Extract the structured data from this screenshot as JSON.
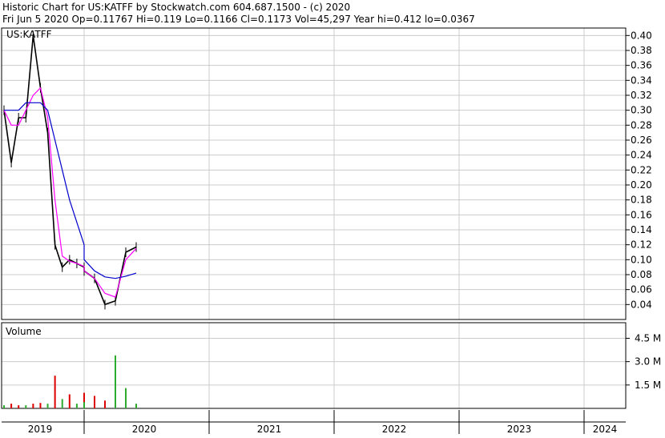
{
  "header": {
    "line1": "Historic Chart for US:KATFF by Stockwatch.com 604.687.1500 - (c) 2020",
    "line2": "Fri Jun  5 2020   Op=0.11767   Hi=0.119   Lo=0.1166   Cl=0.1173   Vol=45,297   Year hi=0.412   lo=0.0367"
  },
  "colors": {
    "price": "#000000",
    "ma_short": "#ff00ff",
    "ma_long": "#0000cc",
    "volume_up": "#2eaa2e",
    "volume_down": "#dd0000",
    "grid": "#cccccc"
  },
  "chart_data": [
    {
      "type": "line",
      "symbol_label": "US:KATFF",
      "ylim": [
        0.02,
        0.41
      ],
      "y_ticks": [
        "0.40",
        "0.38",
        "0.36",
        "0.34",
        "0.32",
        "0.30",
        "0.28",
        "0.26",
        "0.24",
        "0.22",
        "0.20",
        "0.18",
        "0.16",
        "0.14",
        "0.12",
        "0.10",
        "0.08",
        "0.06",
        "0.04"
      ],
      "x_ticks": [
        "2019",
        "2020",
        "2021",
        "2022",
        "2023",
        "2024"
      ],
      "grid": true,
      "series": [
        {
          "key": "price",
          "x": [
            "2019-01",
            "2019-02",
            "2019-03",
            "2019-04",
            "2019-05",
            "2019-06",
            "2019-07",
            "2019-08",
            "2019-09",
            "2019-10",
            "2019-11",
            "2019-12",
            "2020-01",
            "2020-02",
            "2020-03",
            "2020-04",
            "2020-05",
            "2020-06"
          ],
          "values": [
            0.3,
            0.23,
            0.29,
            0.29,
            0.4,
            0.33,
            0.27,
            0.12,
            0.09,
            0.1,
            0.095,
            0.09,
            0.085,
            0.075,
            0.04,
            0.045,
            0.11,
            0.117
          ]
        },
        {
          "key": "ma_short",
          "x": [
            "2019-01",
            "2019-02",
            "2019-03",
            "2019-04",
            "2019-05",
            "2019-06",
            "2019-07",
            "2019-08",
            "2019-09",
            "2019-10",
            "2019-11",
            "2019-12",
            "2020-01",
            "2020-02",
            "2020-03",
            "2020-04",
            "2020-05",
            "2020-06"
          ],
          "values": [
            0.3,
            0.28,
            0.28,
            0.3,
            0.32,
            0.33,
            0.29,
            0.18,
            0.105,
            0.098,
            0.095,
            0.091,
            0.085,
            0.075,
            0.055,
            0.05,
            0.1,
            0.115
          ]
        },
        {
          "key": "ma_long",
          "x": [
            "2019-01",
            "2019-02",
            "2019-03",
            "2019-04",
            "2019-05",
            "2019-06",
            "2019-07",
            "2019-08",
            "2019-09",
            "2019-10",
            "2019-11",
            "2019-12",
            "2020-01",
            "2020-02",
            "2020-03",
            "2020-04",
            "2020-05",
            "2020-06"
          ],
          "values": [
            0.3,
            0.3,
            0.3,
            0.31,
            0.31,
            0.31,
            0.3,
            0.26,
            0.22,
            0.18,
            0.15,
            0.12,
            0.1,
            0.085,
            0.077,
            0.075,
            0.078,
            0.082
          ]
        }
      ]
    },
    {
      "type": "bar",
      "title": "Volume",
      "ylim": [
        0,
        5.5
      ],
      "y_ticks": [
        "4.5 M",
        "3.0 M",
        "1.5 M"
      ],
      "y_tick_values": [
        4.5,
        3.0,
        1.5
      ],
      "x": [
        "2019-01",
        "2019-02",
        "2019-03",
        "2019-04",
        "2019-05",
        "2019-06",
        "2019-07",
        "2019-08",
        "2019-09",
        "2019-10",
        "2019-11",
        "2019-12",
        "2020-01",
        "2020-02",
        "2020-03",
        "2020-04",
        "2020-05",
        "2020-06"
      ],
      "values": [
        0.2,
        0.3,
        0.2,
        0.2,
        0.3,
        0.35,
        0.3,
        2.1,
        0.6,
        0.9,
        0.3,
        1.0,
        0.4,
        0.8,
        0.5,
        3.4,
        1.3,
        0.3
      ],
      "up": [
        true,
        false,
        false,
        true,
        false,
        false,
        true,
        false,
        true,
        false,
        true,
        false,
        true,
        false,
        false,
        true,
        true,
        true
      ]
    }
  ]
}
